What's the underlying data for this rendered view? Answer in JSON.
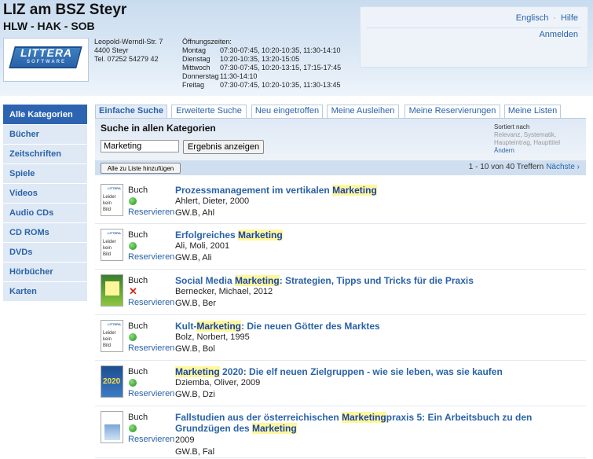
{
  "header": {
    "title": "LIZ am BSZ Steyr",
    "subtitle": "HLW - HAK - SOB",
    "logo_text": "LITTERA",
    "logo_sub": "SOFTWARE",
    "address": [
      "Leopold-Werndl-Str. 7",
      "4400 Steyr",
      "Tel. 07252 54279 42"
    ],
    "hours_title": "Öffnungszeiten:",
    "hours": [
      {
        "day": "Montag",
        "time": "07:30-07:45, 10:20-10:35, 11:30-14:10"
      },
      {
        "day": "Dienstag",
        "time": "10:20-10:35, 13:20-15:05"
      },
      {
        "day": "Mittwoch",
        "time": "07:30-07:45, 10:20-13:15, 17:15-17:45"
      },
      {
        "day": "Donnerstag",
        "time": "11:30-14:10"
      },
      {
        "day": "Freitag",
        "time": "07:30-07:45, 10:20-10:35, 11:30-13:45"
      }
    ],
    "links": {
      "english": "Englisch",
      "help": "Hilfe",
      "login": "Anmelden"
    }
  },
  "sidebar": {
    "items": [
      {
        "label": "Alle Kategorien",
        "active": true
      },
      {
        "label": "Bücher"
      },
      {
        "label": "Zeitschriften"
      },
      {
        "label": "Spiele"
      },
      {
        "label": "Videos"
      },
      {
        "label": "Audio CDs"
      },
      {
        "label": "CD ROMs"
      },
      {
        "label": "DVDs"
      },
      {
        "label": "Hörbücher"
      },
      {
        "label": "Karten"
      }
    ]
  },
  "tabs": [
    {
      "label": "Einfache Suche",
      "active": true
    },
    {
      "label": "Erweiterte Suche"
    },
    {
      "label": "Neu eingetroffen"
    },
    {
      "label": "Meine Ausleihen"
    },
    {
      "label": "Meine Reservierungen"
    },
    {
      "label": "Meine Listen"
    }
  ],
  "search": {
    "heading": "Suche in allen Kategorien",
    "value": "Marketing",
    "button": "Ergebnis anzeigen",
    "sort_label": "Sortiert nach",
    "sort_options": "Relevanz, Systematik, Haupteintrag, Haupttitel",
    "sort_change": "Ändern"
  },
  "results_bar": {
    "add_all": "Alle zu Liste hinzufügen",
    "range": "1 - 10 von 40 Treffern",
    "next": "Nächste ›"
  },
  "results": [
    {
      "type": "Buch",
      "available": true,
      "reserve": "Reservieren",
      "title": [
        {
          "t": "Prozessmanagement im vertikalen "
        },
        {
          "t": "Marketing",
          "hl": true
        }
      ],
      "author": "Ahlert, Dieter, 2000",
      "signature": "GW.B, Ahl",
      "thumb": "noimg"
    },
    {
      "type": "Buch",
      "available": true,
      "reserve": "Reservieren",
      "title": [
        {
          "t": "Erfolgreiches "
        },
        {
          "t": "Marketing",
          "hl": true
        }
      ],
      "author": "Ali, Moli, 2001",
      "signature": "GW.B, Ali",
      "thumb": "noimg"
    },
    {
      "type": "Buch",
      "available": false,
      "reserve": "Reservieren",
      "title": [
        {
          "t": "Social Media "
        },
        {
          "t": "Marketing",
          "hl": true
        },
        {
          "t": ": Strategien, Tipps und Tricks für die Praxis"
        }
      ],
      "author": "Bernecker, Michael, 2012",
      "signature": "GW.B, Ber",
      "thumb": "green"
    },
    {
      "type": "Buch",
      "available": true,
      "reserve": "Reservieren",
      "title": [
        {
          "t": "Kult-"
        },
        {
          "t": "Marketing",
          "hl": true
        },
        {
          "t": ": Die neuen Götter des Marktes"
        }
      ],
      "author": "Bolz, Norbert, 1995",
      "signature": "GW.B, Bol",
      "thumb": "noimg"
    },
    {
      "type": "Buch",
      "available": true,
      "reserve": "Reservieren",
      "title": [
        {
          "t": "Marketing",
          "hl": true
        },
        {
          "t": " 2020: Die elf neuen Zielgruppen - wie sie leben, was sie kaufen"
        }
      ],
      "author": "Dziemba, Oliver, 2009",
      "signature": "GW.B, Dzi",
      "thumb": "blue",
      "thumb_text": "2020"
    },
    {
      "type": "Buch",
      "available": true,
      "reserve": "Reservieren",
      "title": [
        {
          "t": "Fallstudien aus der österreichischen "
        },
        {
          "t": "Marketing",
          "hl": true
        },
        {
          "t": "praxis 5: Ein Arbeitsbuch zu den Grundzügen des "
        },
        {
          "t": "Marketing",
          "hl": true
        }
      ],
      "author": "2009",
      "signature": "GW.B, Fal",
      "thumb": "book"
    }
  ],
  "thumb_noimg_lines": [
    "Leider",
    "kein",
    "Bild"
  ],
  "thumb_brand": "LITTERA",
  "colors": {
    "accent": "#2a62a8",
    "active_nav": "#2d64b2",
    "highlight": "#fff79a",
    "available": "#1f8f1f",
    "unavailable": "#d62a1f"
  }
}
